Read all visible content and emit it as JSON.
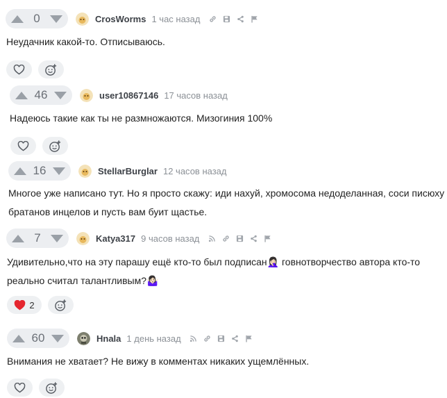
{
  "comments": [
    {
      "score": "0",
      "author": "CrosWorms",
      "time": "1 час назад",
      "text": [
        "Неудачник какой-то. Отписываюсь."
      ],
      "likes": ""
    },
    {
      "score": "46",
      "author": "user10867146",
      "time": "17 часов назад",
      "text": [
        "Надеюсь такие как ты не размножаются. Мизогиния 100%"
      ],
      "likes": ""
    },
    {
      "score": "16",
      "author": "StellarBurglar",
      "time": "12 часов назад",
      "text": [
        "Многое уже написано тут. Но я просто скажу: иди нахуй, хромосома недоделанная, соси писюху",
        "братанов инцелов и пусть вам буит щастье."
      ]
    },
    {
      "score": "7",
      "author": "Katya317",
      "time": "9 часов назад",
      "text": [
        "Удивительно,что на эту парашу ещё кто-то был подписан🤦🏻‍♀️ говнотворчество автора кто-то",
        "реально считал талантливым?🤷🏻‍♀️"
      ],
      "likes": "2"
    },
    {
      "score": "60",
      "author": "Hnala",
      "time": "1 день назад",
      "text": [
        "Внимания не хватает? Не вижу в комментах никаких ущемлённых."
      ]
    }
  ],
  "colors": {
    "vote_bg": "#eceef1",
    "arrow": "#9aa0a7",
    "heart_active": "#e5262f",
    "icon_gray": "#a0a5ab"
  },
  "icons": {
    "upvote": "triangle-up-icon",
    "downvote": "triangle-down-icon",
    "link": "link-icon",
    "save": "floppy-icon",
    "share": "share-icon",
    "report": "flag-icon",
    "rss": "rss-icon",
    "like": "heart-icon",
    "react": "smile-plus-icon"
  }
}
